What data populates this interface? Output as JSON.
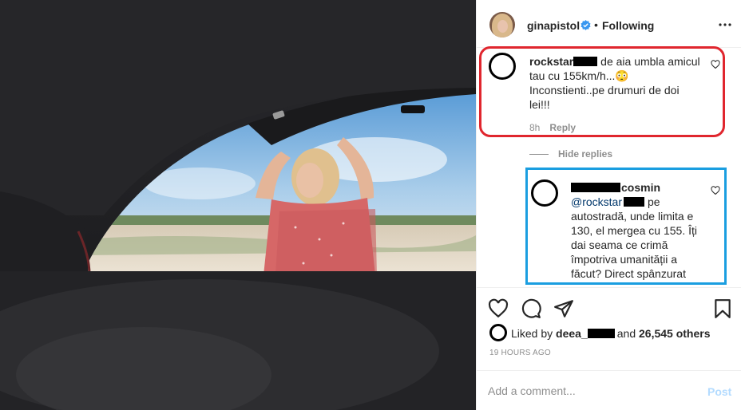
{
  "owner": {
    "username": "ginapistol",
    "follow_status": "Following",
    "separator": "•"
  },
  "comments": [
    {
      "username": "rockstar",
      "text_parts": [
        "de aia umbla amicul",
        "tau cu 155km/h...😳",
        "Inconstienti..pe drumuri de doi",
        "lei!!!"
      ],
      "time": "8h",
      "reply_label": "Reply"
    },
    {
      "username_suffix": "cosmin",
      "mention": "@rockstar",
      "text_parts": [
        "pe",
        "autostradă, unde limita e",
        "130, el mergea cu 155. Îți",
        "dai seama ce crimă",
        "împotriva umanității a",
        "făcut? Direct spânzurat"
      ]
    }
  ],
  "hide_replies_label": "Hide replies",
  "likes": {
    "prefix": "Liked by",
    "liker": "deea_",
    "middle": "and",
    "count": "26,545 others"
  },
  "timestamp": "19 HOURS AGO",
  "add_comment": {
    "placeholder": "Add a comment...",
    "post_label": "Post"
  },
  "colors": {
    "red_highlight": "#e0262e",
    "blue_highlight": "#1a9ee0",
    "verified": "#3897f0",
    "post_disabled": "#b3dbff"
  },
  "icons": [
    "verified-badge-icon",
    "more-options-icon",
    "heart-icon",
    "comment-icon",
    "share-icon",
    "bookmark-icon"
  ]
}
